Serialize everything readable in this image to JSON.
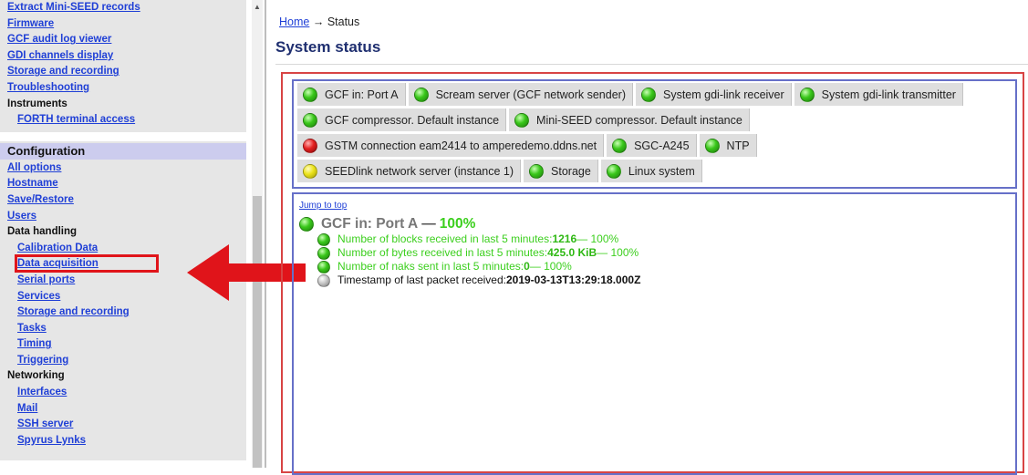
{
  "sidebar": {
    "top_items": [
      {
        "label": "Extract Mini-SEED records",
        "type": "link"
      },
      {
        "label": "Firmware",
        "type": "link"
      },
      {
        "label": "GCF audit log viewer",
        "type": "link"
      },
      {
        "label": "GDI channels display",
        "type": "link"
      },
      {
        "label": "Storage and recording",
        "type": "link"
      },
      {
        "label": "Troubleshooting",
        "type": "link"
      },
      {
        "label": "Instruments",
        "type": "heading"
      },
      {
        "label": "FORTH terminal access",
        "type": "sublink"
      }
    ],
    "configuration": {
      "section_title": "Configuration",
      "all_options": "All options",
      "hostname": "Hostname",
      "save_restore": "Save/Restore",
      "users": "Users",
      "data_handling": "Data handling",
      "calibration_data": "Calibration Data",
      "data_acquisition": "Data acquisition",
      "serial_ports": "Serial ports",
      "services": "Services",
      "storage_and_recording": "Storage and recording",
      "tasks": "Tasks",
      "timing": "Timing",
      "triggering": "Triggering",
      "networking": "Networking",
      "interfaces": "Interfaces",
      "mail": "Mail",
      "ssh_server": "SSH server",
      "spyrus_lynks": "Spyrus Lynks"
    }
  },
  "breadcrumb": {
    "home": "Home",
    "arrow": "→",
    "current": "Status"
  },
  "page_title": "System status",
  "services": {
    "rows": [
      [
        {
          "label": "GCF in: Port A",
          "status": "green"
        },
        {
          "label": "Scream server (GCF network sender)",
          "status": "green"
        },
        {
          "label": "System gdi-link receiver",
          "status": "green"
        },
        {
          "label": "System gdi-link transmitter",
          "status": "green"
        }
      ],
      [
        {
          "label": "GCF compressor. Default instance",
          "status": "green"
        },
        {
          "label": "Mini-SEED compressor. Default instance",
          "status": "green"
        }
      ],
      [
        {
          "label": "GSTM connection eam2414 to amperedemo.ddns.net",
          "status": "red"
        },
        {
          "label": "SGC-A245",
          "status": "green"
        },
        {
          "label": "NTP",
          "status": "green"
        }
      ],
      [
        {
          "label": "SEEDlink network server (instance 1)",
          "status": "yellow"
        },
        {
          "label": "Storage",
          "status": "green"
        },
        {
          "label": "Linux system",
          "status": "green"
        }
      ]
    ]
  },
  "detail": {
    "jump_link": "Jump to top",
    "title": "GCF in: Port A",
    "title_sep": "—",
    "title_pct": "100%",
    "metrics": [
      {
        "label": "Number of blocks received in last 5 minutes: ",
        "value": "1216",
        "suffix": " — 100%",
        "status": "green"
      },
      {
        "label": "Number of bytes received in last 5 minutes: ",
        "value": "425.0 KiB",
        "suffix": " — 100%",
        "status": "green"
      },
      {
        "label": "Number of naks sent in last 5 minutes: ",
        "value": "0",
        "suffix": " — 100%",
        "status": "green"
      },
      {
        "label": "Timestamp of last packet received: ",
        "value": "2019-03-13T13:29:18.000Z",
        "suffix": "",
        "status": "gray"
      }
    ]
  },
  "colors": {
    "link": "#1f3fd6",
    "highlight_box": "#e0141a",
    "arrow": "#e0141a",
    "ok_green": "#3ccf1e",
    "section_bg": "#ccccee"
  }
}
